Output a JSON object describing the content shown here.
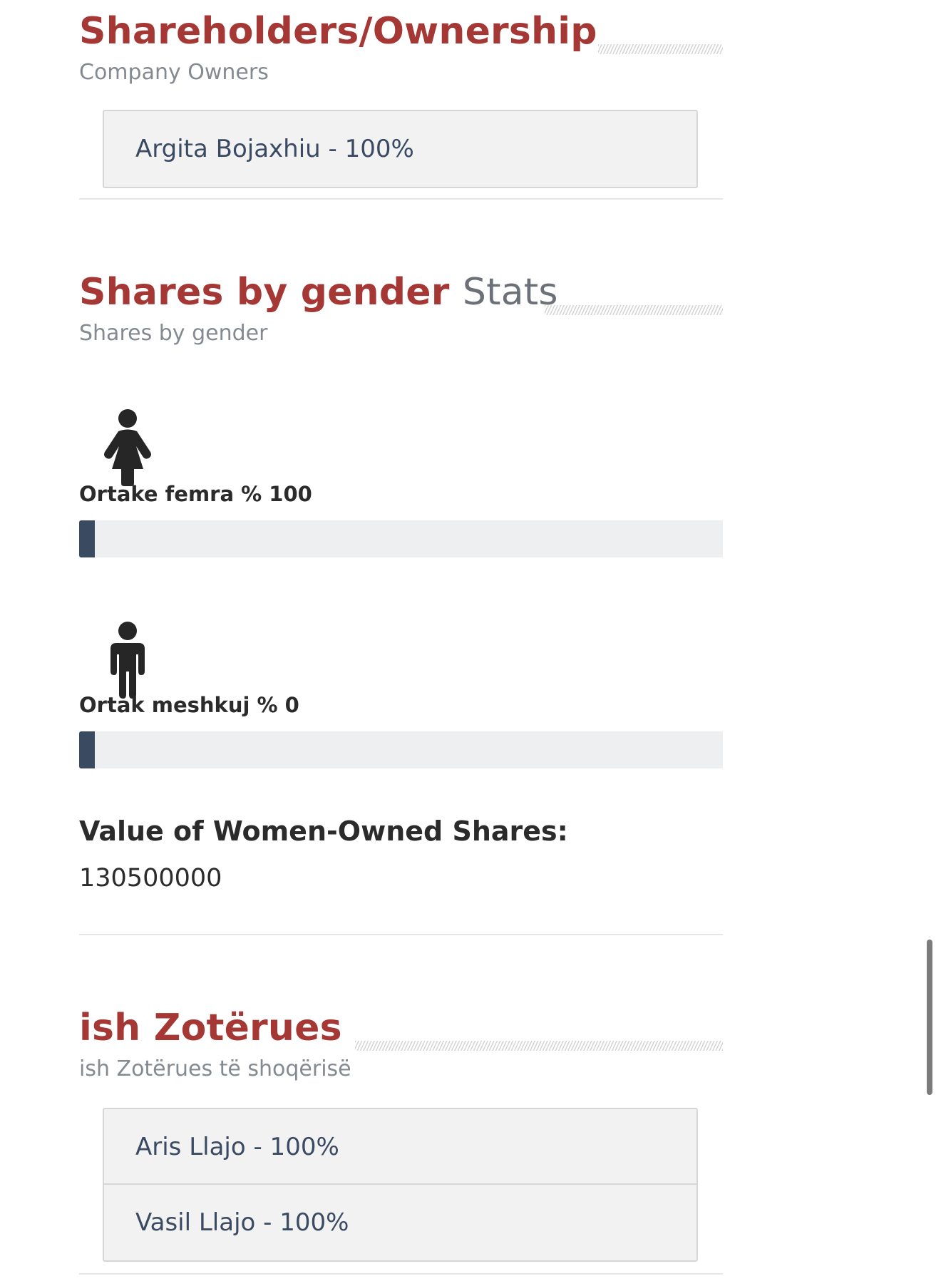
{
  "shareholders": {
    "title": "Shareholders/Ownership",
    "subtitle": "Company Owners",
    "owners": [
      "Argita Bojaxhiu - 100%"
    ]
  },
  "gender": {
    "title_bold": "Shares by gender",
    "title_light": "Stats",
    "subtitle": "Shares by gender",
    "female": {
      "label": "Ortake femra % 100",
      "percent": 100,
      "icon": "female-person-icon"
    },
    "male": {
      "label": "Ortak meshkuj % 0",
      "percent": 0,
      "icon": "male-person-icon"
    },
    "value_label": "Value of Women-Owned Shares:",
    "value": "130500000"
  },
  "former_owners": {
    "title": "ish Zotërues",
    "subtitle": "ish Zotërues të shoqërisë",
    "owners": [
      "Aris Llajo - 100%",
      "Vasil Llajo - 100%"
    ]
  },
  "colors": {
    "accent": "#a53835",
    "bar_fill": "#3a4a60",
    "bar_track": "#eeeff1",
    "box_bg": "#f2f2f2"
  }
}
